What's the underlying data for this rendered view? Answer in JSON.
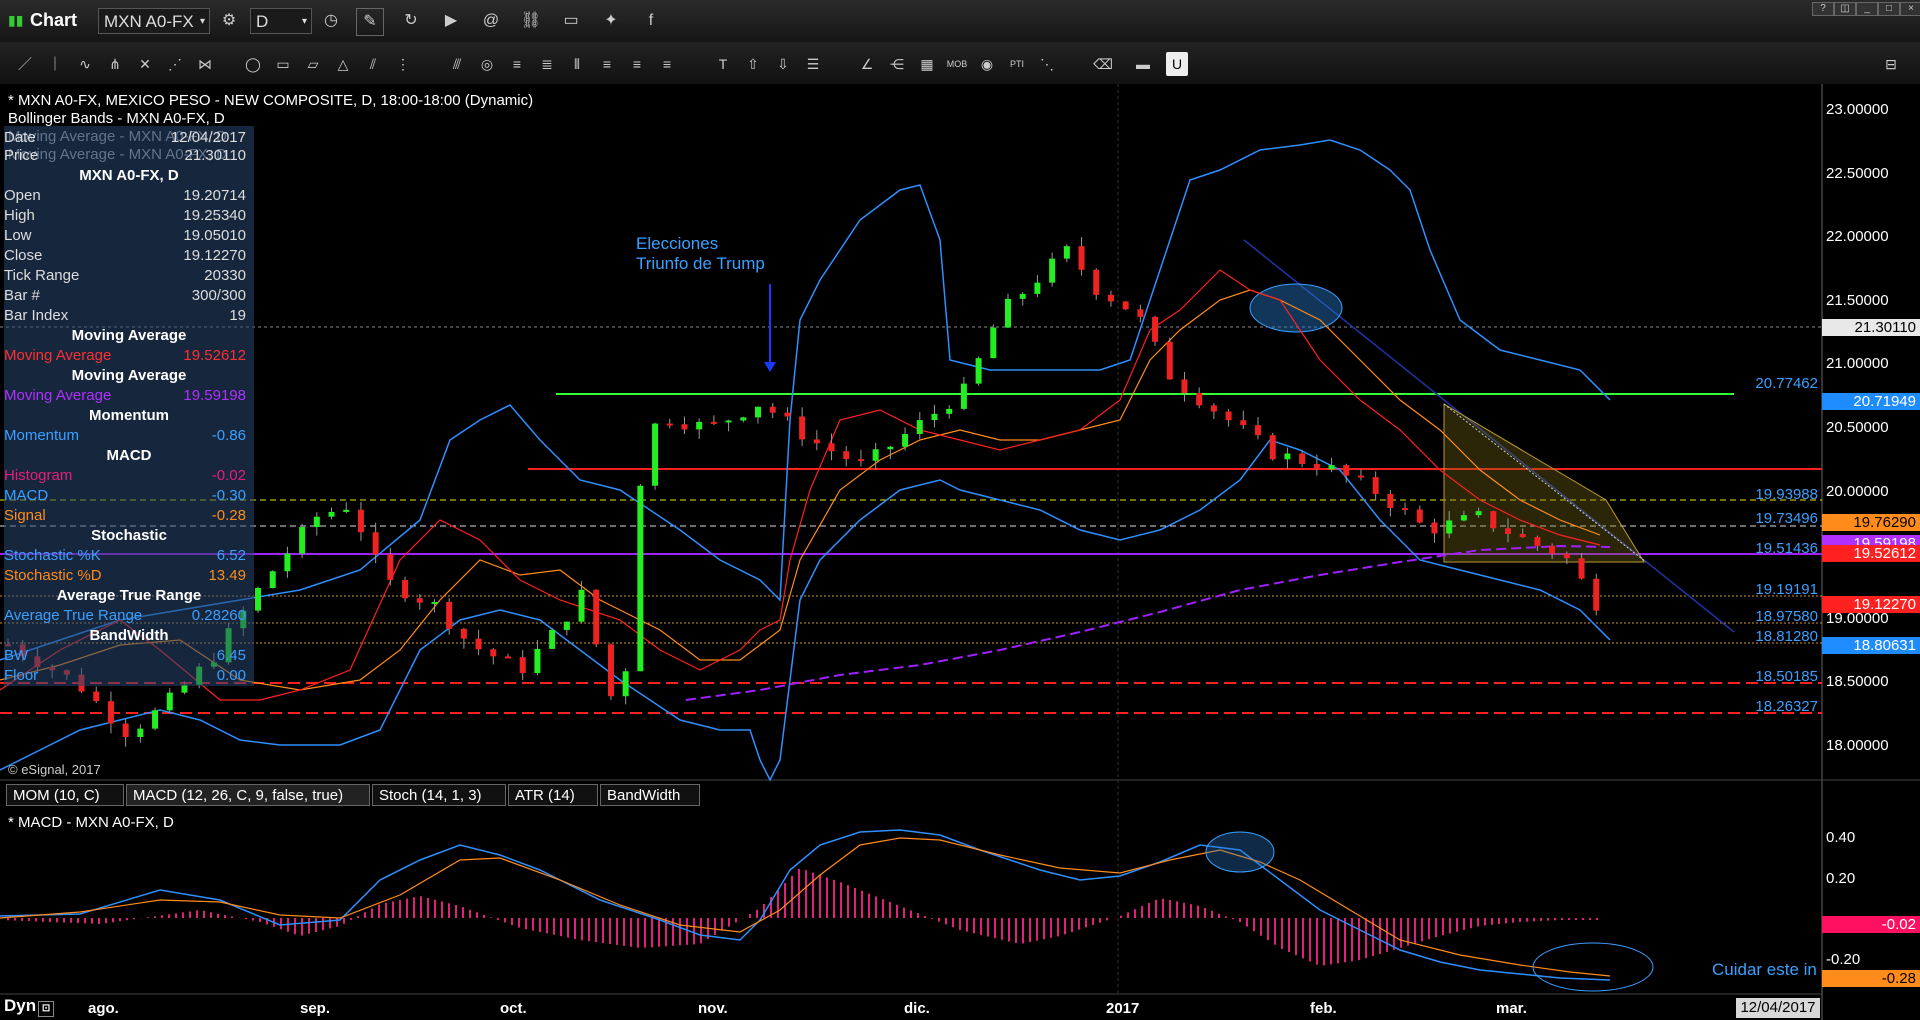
{
  "app": {
    "title": "Chart",
    "symbol": "MXN A0-FX",
    "interval": "D"
  },
  "chart_header": {
    "line1": "* MXN A0-FX, MEXICO PESO - NEW COMPOSITE, D, 18:00-18:00 (Dynamic)",
    "line2": "Bollinger Bands - MXN A0-FX, D",
    "line3": "Moving Average - MXN A0-FX, D",
    "line4": "Moving Average - MXN A0-FX, D"
  },
  "data_window": {
    "date_label": "Date",
    "date_value": "12/04/2017",
    "price_label": "Price",
    "price_value": "21.30110",
    "symbol_title": "MXN A0-FX, D",
    "rows": [
      {
        "label": "Open",
        "value": "19.20714",
        "color": "#ffffff"
      },
      {
        "label": "High",
        "value": "19.25340",
        "color": "#ffffff"
      },
      {
        "label": "Low",
        "value": "19.05010",
        "color": "#ffffff"
      },
      {
        "label": "Close",
        "value": "19.12270",
        "color": "#ffffff"
      },
      {
        "label": "Tick Range",
        "value": "20330",
        "color": "#ffffff"
      },
      {
        "label": "Bar #",
        "value": "300/300",
        "color": "#ffffff"
      },
      {
        "label": "Bar Index",
        "value": "19",
        "color": "#ffffff"
      }
    ],
    "sections": [
      {
        "title": "Moving Average",
        "items": [
          {
            "label": "Moving Average",
            "value": "19.52612",
            "color": "#ff3030"
          }
        ]
      },
      {
        "title": "Moving Average",
        "items": [
          {
            "label": "Moving Average",
            "value": "19.59198",
            "color": "#b030ff"
          }
        ]
      },
      {
        "title": "Momentum",
        "items": [
          {
            "label": "Momentum",
            "value": "-0.86",
            "color": "#3aa0ff"
          }
        ]
      },
      {
        "title": "MACD",
        "items": [
          {
            "label": "Histogram",
            "value": "-0.02",
            "color": "#e0207a"
          },
          {
            "label": "MACD",
            "value": "-0.30",
            "color": "#3aa0ff"
          },
          {
            "label": "Signal",
            "value": "-0.28",
            "color": "#ff8c1a"
          }
        ]
      },
      {
        "title": "Stochastic",
        "items": [
          {
            "label": "Stochastic %K",
            "value": "6.52",
            "color": "#3aa0ff"
          },
          {
            "label": "Stochastic %D",
            "value": "13.49",
            "color": "#ff8c1a"
          }
        ]
      },
      {
        "title": "Average True Range",
        "items": [
          {
            "label": "Average True Range",
            "value": "0.28260",
            "color": "#3aa0ff"
          }
        ]
      },
      {
        "title": "BandWidth",
        "items": [
          {
            "label": "BW",
            "value": "6.45",
            "color": "#3aa0ff"
          },
          {
            "label": "Floor",
            "value": "0.00",
            "color": "#3aa0ff"
          }
        ]
      }
    ]
  },
  "annotations": {
    "elections_line1": "Elecciones",
    "elections_line2": "Triunfo de Trump",
    "cuidar": "Cuidar este in",
    "copyright": "© eSignal, 2017",
    "macd_header": "* MACD - MXN A0-FX, D",
    "dyn": "Dyn"
  },
  "price_axis": [
    "23.00000",
    "22.50000",
    "22.00000",
    "21.50000",
    "21.00000",
    "20.50000",
    "20.00000",
    "19.50000",
    "19.00000",
    "18.50000",
    "18.00000"
  ],
  "price_labels": [
    {
      "text": "21.30110",
      "bg": "#e8e8e8",
      "fg": "#000000"
    },
    {
      "text": "20.77462",
      "bg": "",
      "fg": "#3aa0ff"
    },
    {
      "text": "20.71949",
      "bg": "#1e8cff",
      "fg": "#ffffff"
    },
    {
      "text": "19.93988",
      "bg": "",
      "fg": "#3aa0ff"
    },
    {
      "text": "19.73496",
      "bg": "",
      "fg": "#3aa0ff"
    },
    {
      "text": "19.76290",
      "bg": "#ff8c1a",
      "fg": "#000000"
    },
    {
      "text": "19.59198",
      "bg": "#b030ff",
      "fg": "#ffffff"
    },
    {
      "text": "19.51436",
      "bg": "",
      "fg": "#3aa0ff"
    },
    {
      "text": "19.52612",
      "bg": "#ff2020",
      "fg": "#ffffff"
    },
    {
      "text": "19.19191",
      "bg": "",
      "fg": "#3aa0ff"
    },
    {
      "text": "19.12270",
      "bg": "#ff2020",
      "fg": "#ffffff"
    },
    {
      "text": "18.97580",
      "bg": "",
      "fg": "#3aa0ff"
    },
    {
      "text": "18.81280",
      "bg": "",
      "fg": "#3aa0ff"
    },
    {
      "text": "18.80631",
      "bg": "#1e8cff",
      "fg": "#ffffff"
    },
    {
      "text": "18.50185",
      "bg": "",
      "fg": "#3aa0ff"
    },
    {
      "text": "18.26327",
      "bg": "",
      "fg": "#3aa0ff"
    }
  ],
  "macd_axis": [
    "0.40",
    "0.20",
    "-0.20"
  ],
  "macd_labels": [
    {
      "text": "-0.02",
      "bg": "#ff1060",
      "fg": "#ffffff"
    },
    {
      "text": "-0.28",
      "bg": "#ff8c1a",
      "fg": "#000000"
    }
  ],
  "tabs": [
    "MOM (10, C)",
    "MACD (12, 26, C, 9, false, true)",
    "Stoch (14, 1, 3)",
    "ATR (14)",
    "BandWidth"
  ],
  "months": [
    "ago.",
    "sep.",
    "oct.",
    "nov.",
    "dic.",
    "2017",
    "feb.",
    "mar."
  ],
  "date_box": "12/04/2017",
  "chart_data": {
    "type": "line",
    "title": "MXN A0-FX, MEXICO PESO - NEW COMPOSITE, D",
    "xlabel": "",
    "ylabel": "",
    "ylim": [
      18.0,
      23.0
    ],
    "x": [
      "ago.",
      "sep.",
      "oct.",
      "nov.",
      "dic.",
      "2017",
      "feb.",
      "mar."
    ],
    "series": [
      {
        "name": "Close",
        "values": [
          18.6,
          18.5,
          19.8,
          18.9,
          20.6,
          20.3,
          21.9,
          20.4,
          19.12
        ]
      }
    ],
    "grid": false
  }
}
